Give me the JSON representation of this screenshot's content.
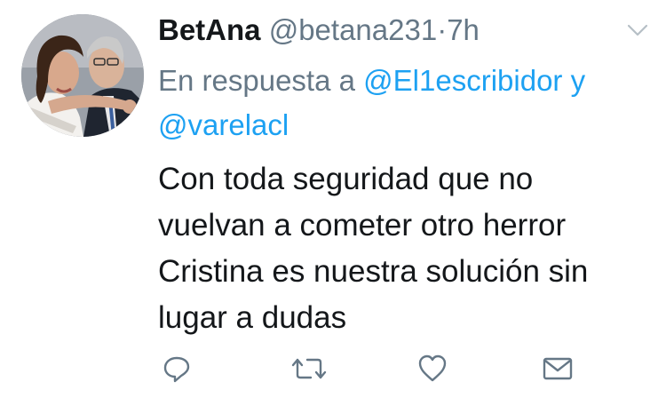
{
  "tweet": {
    "author": {
      "display_name": "BetAna",
      "handle": "@betana231",
      "separator": "·",
      "time": "7h"
    },
    "reply": {
      "prefix": "En respuesta a",
      "mention_1": "@El1escribidor",
      "conjunction": "y",
      "mention_2": "@varelacl"
    },
    "text_lines": [
      "Con toda seguridad que no",
      "vuelvan a cometer otro herror",
      "Cristina es nuestra solución sin",
      "lugar a dudas"
    ],
    "actions": {
      "reply_icon": "speech-bubble-icon",
      "retweet_icon": "retweet-arrows-icon",
      "like_icon": "heart-icon",
      "dm_icon": "envelope-icon"
    },
    "colors": {
      "text": "#14171a",
      "secondary": "#657786",
      "link": "#1da1f2",
      "icon": "#657786"
    }
  }
}
